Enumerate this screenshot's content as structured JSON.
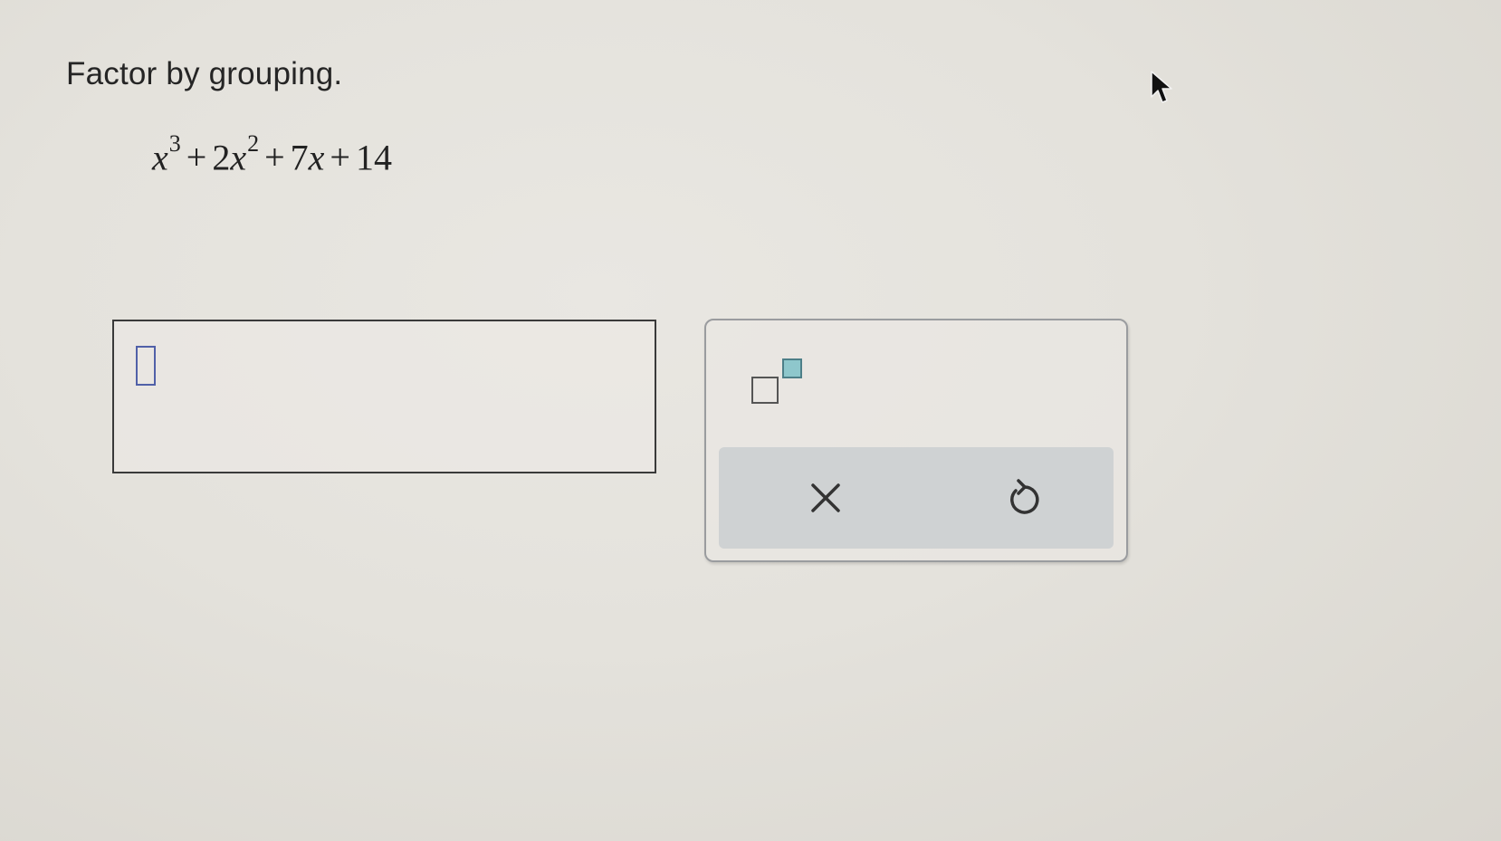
{
  "question": {
    "instruction": "Factor by grouping.",
    "expression": {
      "t1_var": "x",
      "t1_exp": "3",
      "op1": "+",
      "t2_coef": "2",
      "t2_var": "x",
      "t2_exp": "2",
      "op2": "+",
      "t3_coef": "7",
      "t3_var": "x",
      "op3": "+",
      "t4_const": "14"
    }
  },
  "answer": {
    "value": ""
  },
  "palette": {
    "buttons": [
      {
        "icon": "exponent-template-icon",
        "action": "superscript"
      },
      {
        "icon": "close-icon",
        "action": "clear"
      },
      {
        "icon": "undo-icon",
        "action": "undo"
      }
    ],
    "accent_color": "#8ec7cc",
    "bar_color": "#cfd2d3"
  },
  "colors": {
    "slot_border": "#5060a8"
  }
}
